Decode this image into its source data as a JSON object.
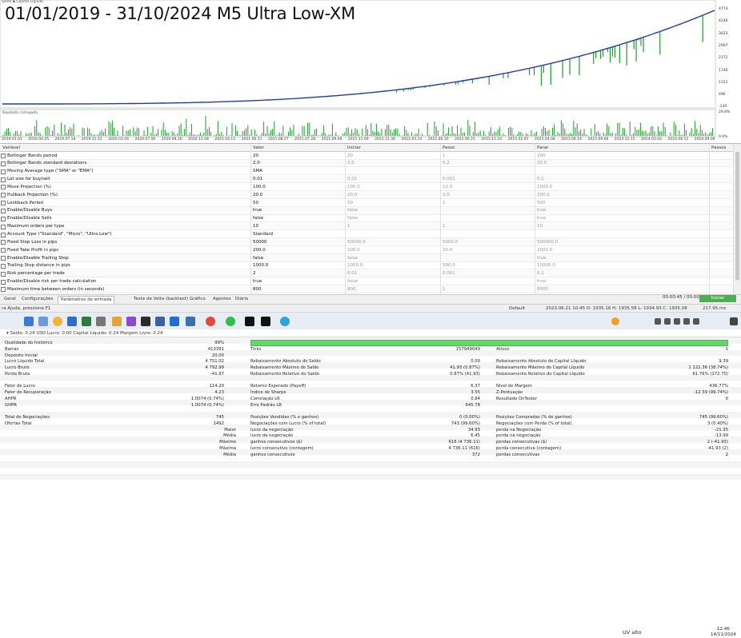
{
  "chart": {
    "overlay_title": "01/01/2019 - 31/10/2024 M5 Ultra Low-XM",
    "legend_top": "Saldo ▪ Capital Líquido",
    "legend_deposit": "Depósito carregado",
    "y_labels": [
      "4774",
      "4248",
      "3623",
      "2997",
      "2372",
      "1746",
      "1121",
      "496",
      "-130"
    ],
    "y2_labels": [
      "29.8%",
      "0.0%"
    ],
    "x_labels": [
      "2019.01.01",
      "2019.04.25",
      "2019.07.18",
      "2019.11.12",
      "2020.03.04",
      "2020.07.06",
      "2020.08.26",
      "2020.12.08",
      "2021.04.13",
      "2021.06.11",
      "2021.08.27",
      "2021.07.28",
      "2021.09.09",
      "2021.11.09",
      "2021.12.30",
      "2022.03.14",
      "2022.06.10",
      "2022.06.21",
      "2022.11.10",
      "2023.02.01",
      "2023.04.08",
      "2023.06.16",
      "2023.09.06",
      "2023.12.15",
      "2024.03.04",
      "2024.06.12",
      "2024.09.06"
    ],
    "colors": {
      "balance": "#1f3fa0",
      "equity": "#1e9e2a",
      "deposit": "#1e9e2a"
    }
  },
  "params": {
    "columns": [
      "Variável",
      "Valor",
      "Iniciar",
      "Passo",
      "Parar",
      "Passos"
    ],
    "rows": [
      {
        "name": "Bollinger Bands period",
        "value": "20",
        "start": "20",
        "step": "1",
        "stop": "200"
      },
      {
        "name": "Bollinger Bands standard deviations",
        "value": "2.0",
        "start": "2.0",
        "step": "0.2",
        "stop": "20.0"
      },
      {
        "name": "Moving Average type (\"SMA\" or \"EMA\")",
        "value": "SMA",
        "start": "",
        "step": "",
        "stop": ""
      },
      {
        "name": "Lot size for buy/sell",
        "value": "0.01",
        "start": "0.01",
        "step": "0.001",
        "stop": "0.1"
      },
      {
        "name": "Move Projection (%)",
        "value": "100.0",
        "start": "100.0",
        "step": "10.0",
        "stop": "1000.0"
      },
      {
        "name": "Pullback Projection (%)",
        "value": "20.0",
        "start": "20.0",
        "step": "2.0",
        "stop": "200.0"
      },
      {
        "name": "Lookback Period",
        "value": "50",
        "start": "50",
        "step": "1",
        "stop": "500"
      },
      {
        "name": "Enable/Disable Buys",
        "value": "true",
        "start": "false",
        "step": "",
        "stop": "true"
      },
      {
        "name": "Enable/Disable Sells",
        "value": "false",
        "start": "false",
        "step": "",
        "stop": "true"
      },
      {
        "name": "Maximum orders per type",
        "value": "10",
        "start": "1",
        "step": "1",
        "stop": "10"
      },
      {
        "name": "Account Type (\"Standard\", \"Micro\", \"Ultra Low\")",
        "value": "Standard",
        "start": "",
        "step": "",
        "stop": ""
      },
      {
        "name": "Fixed Stop Loss in pips",
        "value": "50000",
        "start": "50000.0",
        "step": "5000.0",
        "stop": "500000.0"
      },
      {
        "name": "Fixed Take Profit in pips",
        "value": "200.0",
        "start": "200.0",
        "step": "20.0",
        "stop": "2000.0"
      },
      {
        "name": "Enable/Disable Trailing Stop",
        "value": "false",
        "start": "false",
        "step": "",
        "stop": "true"
      },
      {
        "name": "Trailing Stop distance in pips",
        "value": "1000.0",
        "start": "1000.0",
        "step": "500.0",
        "stop": "10000.0"
      },
      {
        "name": "Risk percentage per trade",
        "value": "2",
        "start": "0.01",
        "step": "0.001",
        "stop": "0.1"
      },
      {
        "name": "Enable/Disable risk per trade calculation",
        "value": "true",
        "start": "false",
        "step": "",
        "stop": "true"
      },
      {
        "name": "Maximum time between orders (in seconds)",
        "value": "800",
        "start": "800",
        "step": "1",
        "stop": "8000"
      }
    ]
  },
  "tabs": [
    "Geral",
    "Configurações",
    "Parâmetros de entrada",
    "Teste de Volta (backtest)",
    "Gráfico",
    "Agentes",
    "Diário"
  ],
  "active_tab": 2,
  "time_readout": "00:00:45 / 00:00:45",
  "start_button": "Iniciar",
  "statusbar": {
    "help": "ra Ajuda, pressione F1",
    "profile": "Default",
    "ohlc": "2023.06.21 10:45   O: 1935.16   H: 1935.58   L: 1934.93   C: 1935.08",
    "traffic": "217.95 ms"
  },
  "taskbar": {
    "uv": "UV alto",
    "time": "12:46",
    "date": "14/11/2024"
  },
  "balance_line": "▾  Saldo: 0.24 USD  Lucro: 0.00  Capital Líquido: 0.24  Margem Livre: 0.24",
  "report": {
    "quality_label": "Qualidade do histórico",
    "quality_value": "99%",
    "quality_fill": 1.0,
    "col1": [
      [
        "Barras",
        "413391"
      ],
      [
        "Depósito Inicial",
        "20.00"
      ],
      [
        "Lucro Líquido Total",
        "4 751.02"
      ],
      [
        "Lucro Bruto",
        "4 792.99"
      ],
      [
        "Perda Bruta",
        "-41.97"
      ],
      [
        "",
        ""
      ],
      [
        "Fator de Lucro",
        "114.20"
      ],
      [
        "Fator de Recuperação",
        "4.23"
      ],
      [
        "AHPR",
        "1.0074 (0.74%)"
      ],
      [
        "GHPR",
        "1.0074 (0.74%)"
      ],
      [
        "",
        ""
      ],
      [
        "Total de Negociações",
        "745"
      ],
      [
        "Ofertas Total",
        "1492"
      ]
    ],
    "col2": [
      [
        "Ticks",
        "157949049"
      ],
      [
        "",
        ""
      ],
      [
        "Rebaixamento Absoluto do Saldo",
        "0.00"
      ],
      [
        "Rebaixamento Máximo do Saldo",
        "41.93 (0.87%)"
      ],
      [
        "Rebaixamento Relativo do Saldo",
        "0.87% (41.93)"
      ],
      [
        "",
        ""
      ],
      [
        "Retorno Esperado (Payoff)",
        "6.37"
      ],
      [
        "Índice de Sharpe",
        "3.55"
      ],
      [
        "Correlação LR",
        "0.84"
      ],
      [
        "Erro Padrão LR",
        "645.78"
      ],
      [
        "",
        ""
      ],
      [
        "Posições Vendidas (% e ganhos)",
        "0 (0.00%)"
      ],
      [
        "Negociações com Lucro (% of total)",
        "743 (99.60%)"
      ]
    ],
    "col3": [
      [
        "Ativos",
        "1"
      ],
      [
        "",
        ""
      ],
      [
        "Rebaixamento Absoluto do Capital Líquido",
        "9.39"
      ],
      [
        "Rebaixamento Máximo do Capital Líquido",
        "1 122.36 (38.74%)"
      ],
      [
        "Rebaixamento Relativo do Capital Líquido",
        "61.76% (172.70)"
      ],
      [
        "",
        ""
      ],
      [
        "Nível de Margem",
        "436.77%"
      ],
      [
        "Z-Pontuação",
        "-12.39 (99.74%)"
      ],
      [
        "Resultado OnTester",
        "0"
      ],
      [
        "",
        ""
      ],
      [
        "",
        ""
      ],
      [
        "Posições Compradas (% de ganhos)",
        "745 (99.60%)"
      ],
      [
        "Negociações com Perda (% of total)",
        "3 (0.40%)"
      ]
    ],
    "lower": [
      {
        "k": "Maior",
        "l2": "lucro da negociação",
        "v2": "34.93",
        "l3": "perda na Negociação",
        "v3": "-21.35"
      },
      {
        "k": "Média",
        "l2": "lucro da negociação",
        "v2": "6.45",
        "l3": "perda na negociação",
        "v3": "-13.99"
      },
      {
        "k": "Máximo",
        "l2": "ganhos consecutivos ($)",
        "v2": "616 (4 736.11)",
        "l3": "perdas consecutivas ($)",
        "v3": "2 (-41.93)"
      },
      {
        "k": "Máxima",
        "l2": "lucro consecutivo (contagem)",
        "v2": "4 736.11 (616)",
        "l3": "perda consecutiva (contagem)",
        "v3": "-41.93 (2)"
      },
      {
        "k": "Média",
        "l2": "ganhos consecutivos",
        "v2": "372",
        "l3": "perdas consecutivas",
        "v3": "2"
      }
    ]
  }
}
